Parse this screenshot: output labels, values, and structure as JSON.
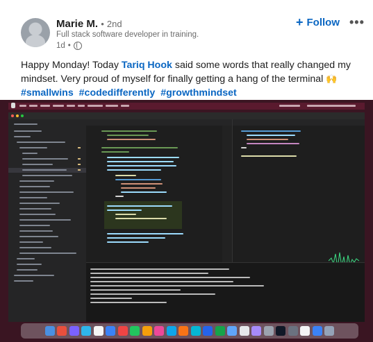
{
  "author": {
    "name": "Marie M.",
    "separator": "•",
    "degree": "2nd",
    "headline": "Full stack software developer in training.",
    "time": "1d",
    "meta_separator": "•",
    "visibility_icon": "globe-icon"
  },
  "actions": {
    "follow_label": "Follow",
    "follow_icon": "plus-icon",
    "more_label": "•••"
  },
  "post": {
    "text_before": "Happy Monday! Today ",
    "mention": "Tariq Hook",
    "text_after": " said some words that really changed my mindset. Very proud of myself for finally getting a hang of the terminal ",
    "emoji": "🙌",
    "hashtags": [
      "#smallwins",
      "#codedifferently",
      "#growthmindset"
    ]
  },
  "colors": {
    "link": "#0a66c2",
    "text": "#1d1d1d",
    "muted": "#6b6b6b",
    "screenshot_bg": "#3a1522",
    "editor_bg": "#1e1e1e"
  },
  "image": {
    "description_icon": "vscode-screenshot"
  }
}
